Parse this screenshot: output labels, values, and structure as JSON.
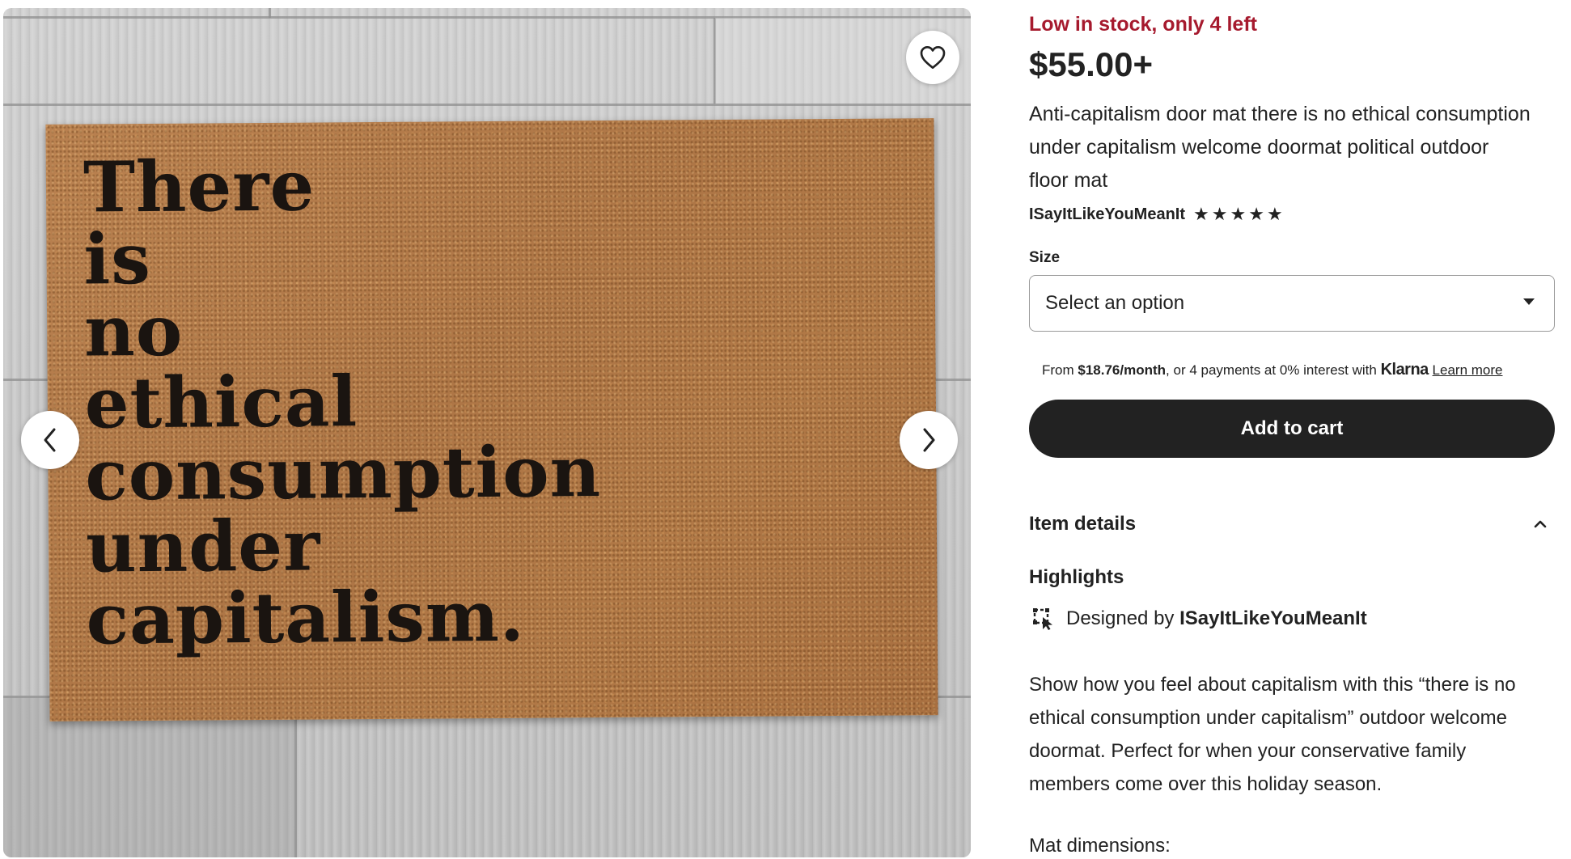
{
  "gallery": {
    "mat_text": "There\nis\nno\nethical\nconsumption\nunder\ncapitalism.",
    "favorite_icon": "heart-outline-icon",
    "prev_icon": "chevron-left-icon",
    "next_icon": "chevron-right-icon"
  },
  "listing": {
    "stock_notice": "Low in stock, only 4 left",
    "price": "$55.00+",
    "title": "Anti-capitalism door mat there is no ethical consumption under capitalism welcome doormat political outdoor floor mat",
    "shop_name": "ISayItLikeYouMeanIt",
    "rating_stars": 5,
    "star_glyph": "★"
  },
  "size": {
    "label": "Size",
    "selected": "Select an option"
  },
  "klarna": {
    "prefix": "From ",
    "amount": "$18.76/month",
    "middle": ", or 4 payments at 0% interest with ",
    "brand": "Klarna",
    "learn_more": "Learn more"
  },
  "cart": {
    "label": "Add to cart"
  },
  "details": {
    "label": "Item details",
    "highlights_label": "Highlights",
    "designed_by_prefix": "Designed by ",
    "designed_by_shop": "ISayItLikeYouMeanIt",
    "description": "Show how you feel about capitalism with this “there is no ethical consumption under capitalism” outdoor welcome doormat. Perfect for when your conservative family members come over this holiday season.",
    "dimensions_label": "Mat dimensions:"
  },
  "colors": {
    "stock_red": "#a61a2e",
    "button_dark": "#222222",
    "text": "#222222"
  }
}
